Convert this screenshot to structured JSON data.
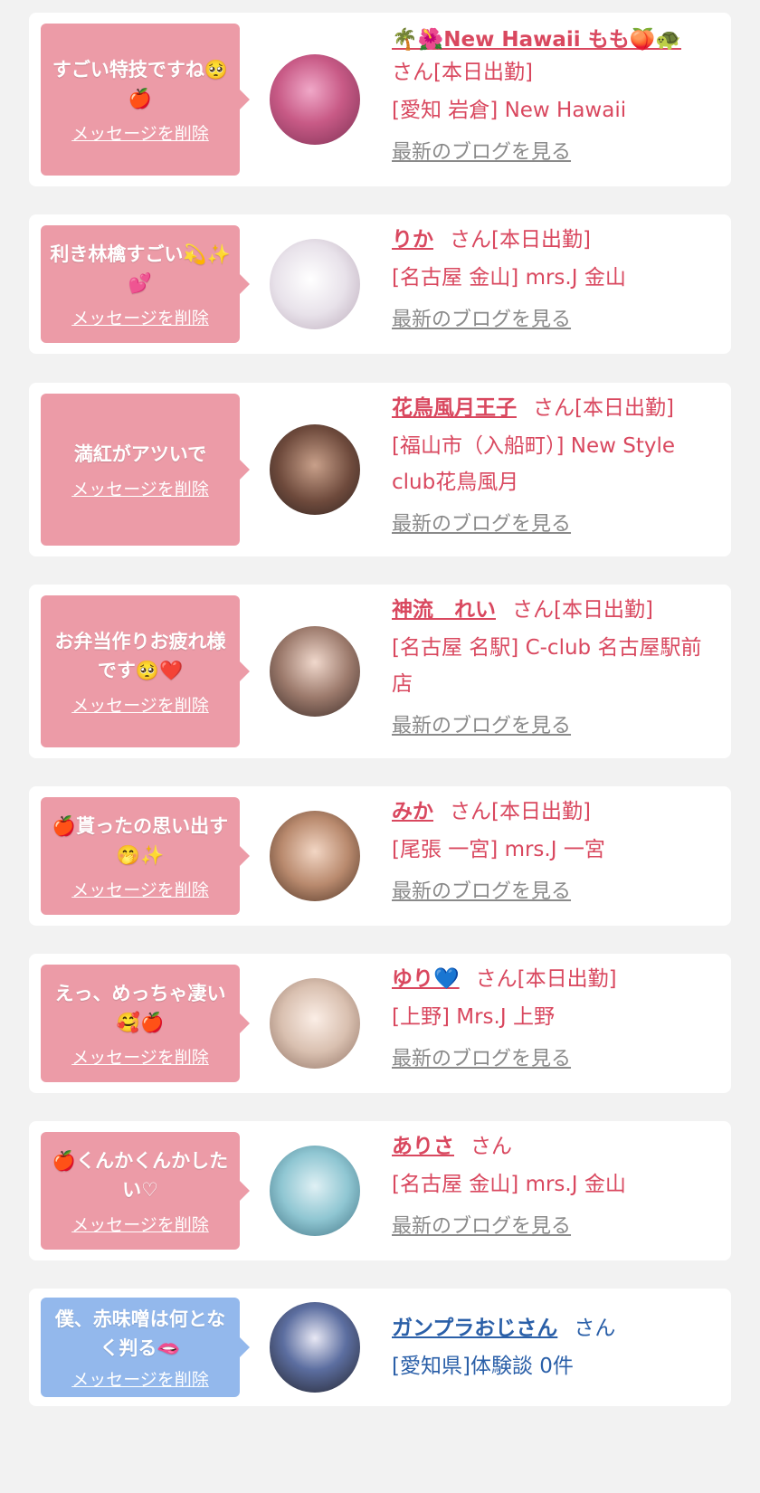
{
  "delete_label": "メッセージを削除",
  "blog_label": "最新のブログを見る",
  "san_suffix": "さん",
  "cards": [
    {
      "message": "すごい特技ですね🥺🍎",
      "name": "🌴🌺New Hawaii もも🍑🐢",
      "status": "さん[本日出勤]",
      "shop": "[愛知 岩倉] New Hawaii",
      "blog": "最新のブログを見る",
      "avatar_icon": "avatar-photo"
    },
    {
      "message": "利き林檎すごい💫✨💕",
      "name": "りか",
      "status": "さん[本日出勤]",
      "shop": "[名古屋 金山] mrs.J 金山",
      "blog": "最新のブログを見る",
      "avatar_icon": "avatar-photo"
    },
    {
      "message": "満紅がアツいで",
      "name": "花鳥風月王子",
      "status": "さん[本日出勤]",
      "shop": "[福山市（入船町）] New Style club花鳥風月",
      "blog": "最新のブログを見る",
      "avatar_icon": "avatar-photo"
    },
    {
      "message": "お弁当作りお疲れ様です🥺❤️",
      "name": "神流　れい",
      "status": "さん[本日出勤]",
      "shop": "[名古屋 名駅] C-club 名古屋駅前店",
      "blog": "最新のブログを見る",
      "avatar_icon": "avatar-photo"
    },
    {
      "message": "🍎貰ったの思い出す🤭✨",
      "name": "みか",
      "status": "さん[本日出勤]",
      "shop": "[尾張 一宮] mrs.J 一宮",
      "blog": "最新のブログを見る",
      "avatar_icon": "avatar-photo"
    },
    {
      "message": "えっ、めっちゃ凄い🥰🍎",
      "name": "ゆり💙",
      "status": "さん[本日出勤]",
      "shop": "[上野] Mrs.J 上野",
      "blog": "最新のブログを見る",
      "avatar_icon": "avatar-photo"
    },
    {
      "message": "🍎くんかくんかしたい♡",
      "name": "ありさ",
      "status": "さん",
      "shop": "[名古屋 金山] mrs.J 金山",
      "blog": "最新のブログを見る",
      "avatar_icon": "avatar-photo"
    },
    {
      "message": "僕、赤味噌は何となく判る🫦",
      "name": "ガンプラおじさん",
      "status": "さん",
      "shop": "[愛知県]体験談 0件",
      "avatar_icon": "avatar-photo"
    }
  ],
  "colors": {
    "background": "#f2f2f2",
    "pink_bubble": "#ec9ba7",
    "blue_bubble": "#93b8ec",
    "pink_text": "#d9485f",
    "blue_text": "#2a5fa8",
    "blog_link": "#8a8a8a"
  }
}
